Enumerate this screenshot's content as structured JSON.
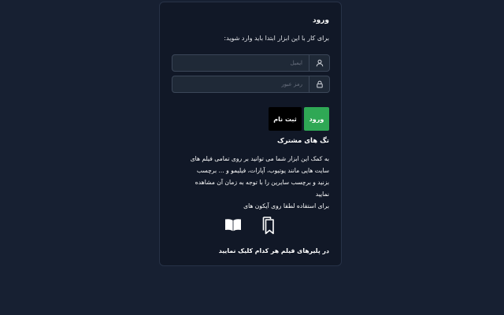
{
  "login": {
    "title": "ورود",
    "subtitle": "برای کار با این ابزار ابتدا باید وارد شوید:",
    "email_placeholder": "ایمیل",
    "password_placeholder": "رمز عبور",
    "login_button": "ورود",
    "register_button": "ثبت نام",
    "login_button_color": "#2fa855",
    "register_button_color": "#000000"
  },
  "shared_tags": {
    "title": "تگ های مشترک",
    "description_lines": [
      "به کمک این ابزار شما می توانید بر روی تمامی فیلم های",
      "سایت هایی مانند یوتیوب، آپارات، فیلیمو و ... برچسب",
      "بزنید و برچسب سایرین را با توجه به زمان آن مشاهده",
      "نمایید",
      "برای استفاده لطفا روی آیکون های"
    ],
    "icons": [
      "tags-icon",
      "book-icon"
    ],
    "footer": "در پلیرهای فیلم هر کدام کلیک نمایید"
  }
}
